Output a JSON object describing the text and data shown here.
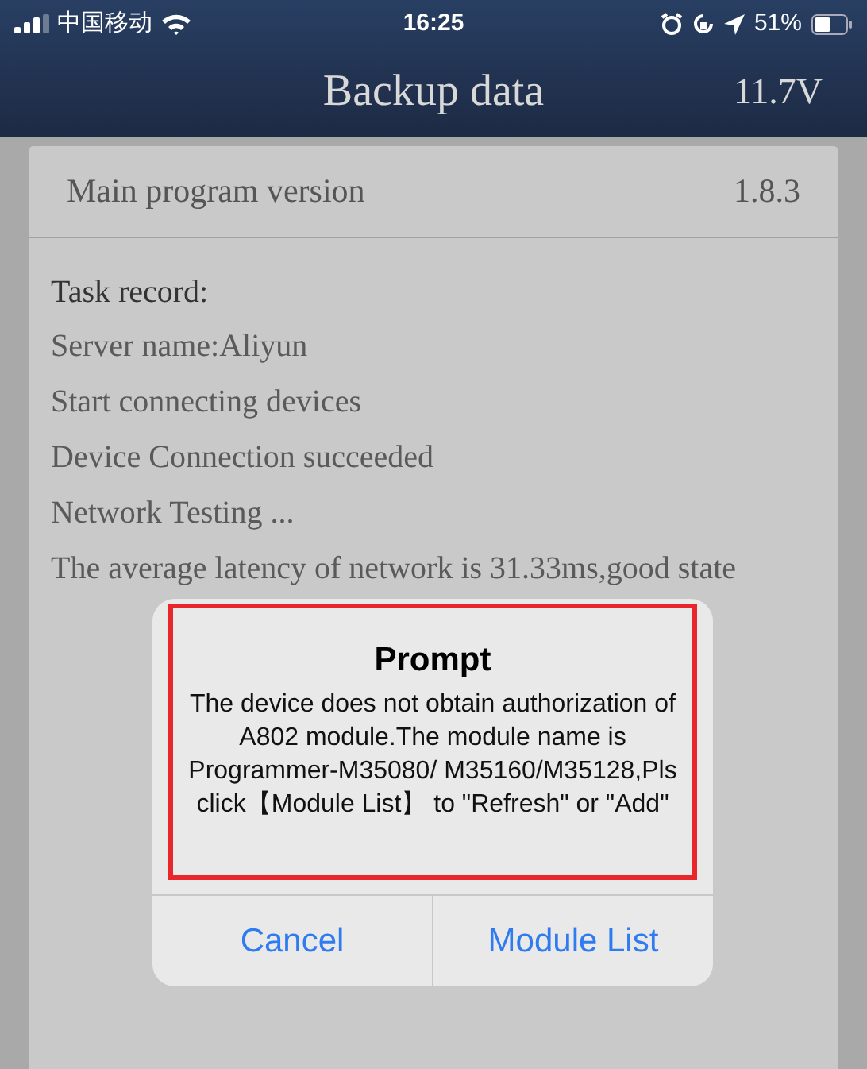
{
  "status_bar": {
    "carrier": "中国移动",
    "time": "16:25",
    "battery": "51%"
  },
  "header": {
    "title": "Backup data",
    "voltage": "11.7V"
  },
  "version": {
    "label": "Main program version",
    "value": "1.8.3"
  },
  "task_record": {
    "title": "Task record:",
    "lines": [
      "Server name:Aliyun",
      "Start connecting devices",
      "Device Connection succeeded",
      "Network Testing ...",
      "The average latency of network is 31.33ms,good state"
    ]
  },
  "dialog": {
    "title": "Prompt",
    "message": "The device does not obtain authorization of A802 module.The module name is Programmer-M35080/ M35160/M35128,Pls click【Module List】 to \"Refresh\" or \"Add\"",
    "buttons": [
      "Cancel",
      "Module List"
    ]
  }
}
